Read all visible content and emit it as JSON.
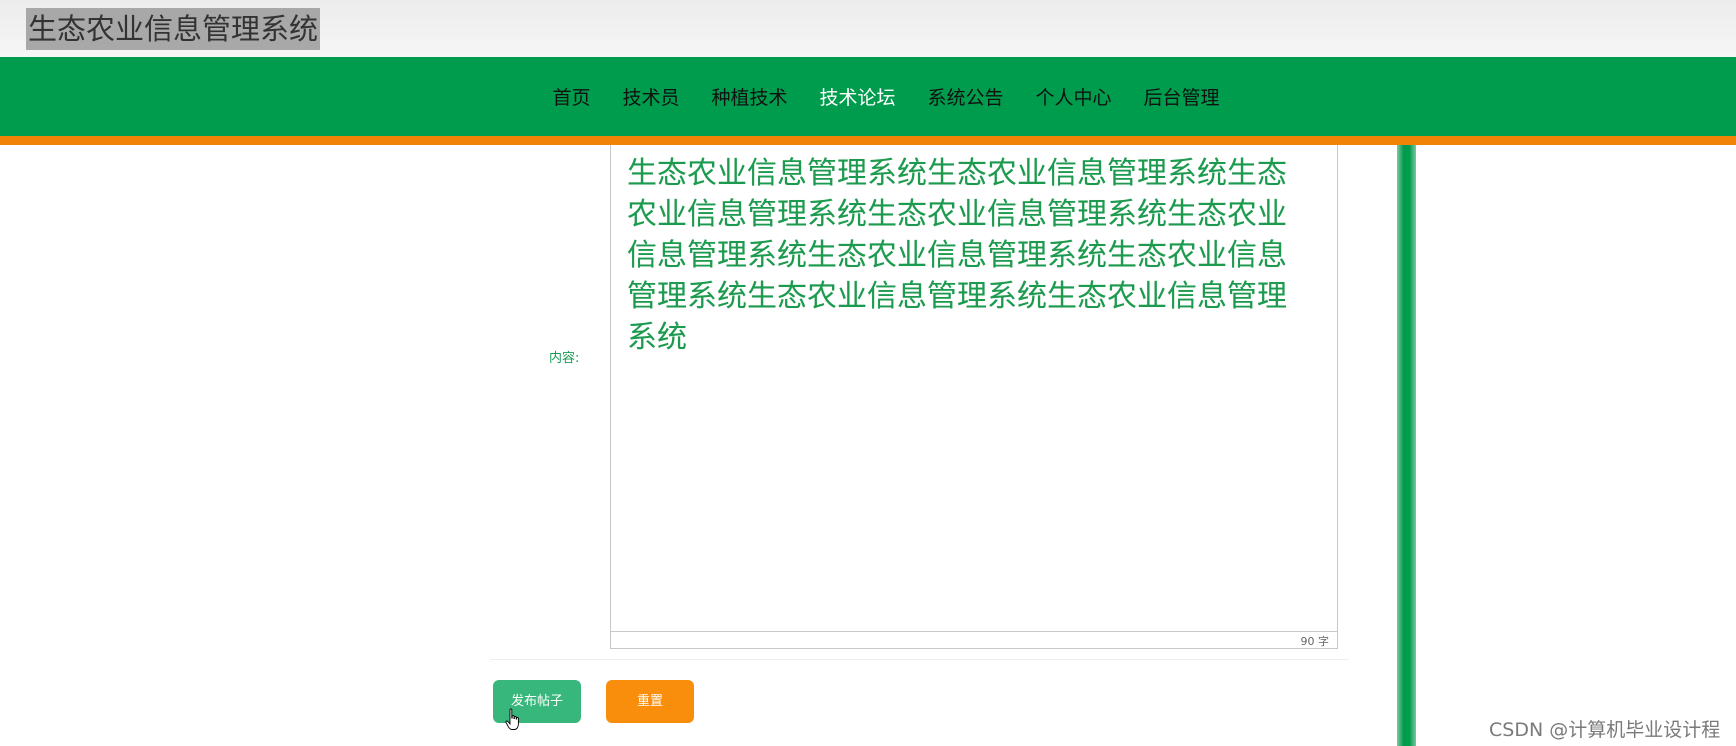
{
  "header": {
    "title": "生态农业信息管理系统"
  },
  "nav": {
    "items": [
      {
        "label": "首页",
        "active": false
      },
      {
        "label": "技术员",
        "active": false
      },
      {
        "label": "种植技术",
        "active": false
      },
      {
        "label": "技术论坛",
        "active": true
      },
      {
        "label": "系统公告",
        "active": false
      },
      {
        "label": "个人中心",
        "active": false
      },
      {
        "label": "后台管理",
        "active": false
      }
    ]
  },
  "form": {
    "content_label": "内容:",
    "editor_text": "生态农业信息管理系统生态农业信息管理系统生态农业信息管理系统生态农业信息管理系统生态农业信息管理系统生态农业信息管理系统生态农业信息管理系统生态农业信息管理系统生态农业信息管理系统",
    "word_count": "90 字",
    "publish_label": "发布帖子",
    "reset_label": "重置"
  },
  "watermark": "CSDN @计算机毕业设计程",
  "colors": {
    "nav_bg": "#009c4d",
    "accent_orange": "#f18407",
    "publish_btn": "#37b77b",
    "reset_btn": "#f98d0c",
    "content_text": "#1c9a4f"
  },
  "icons": {
    "cursor": "hand-pointer-icon"
  }
}
